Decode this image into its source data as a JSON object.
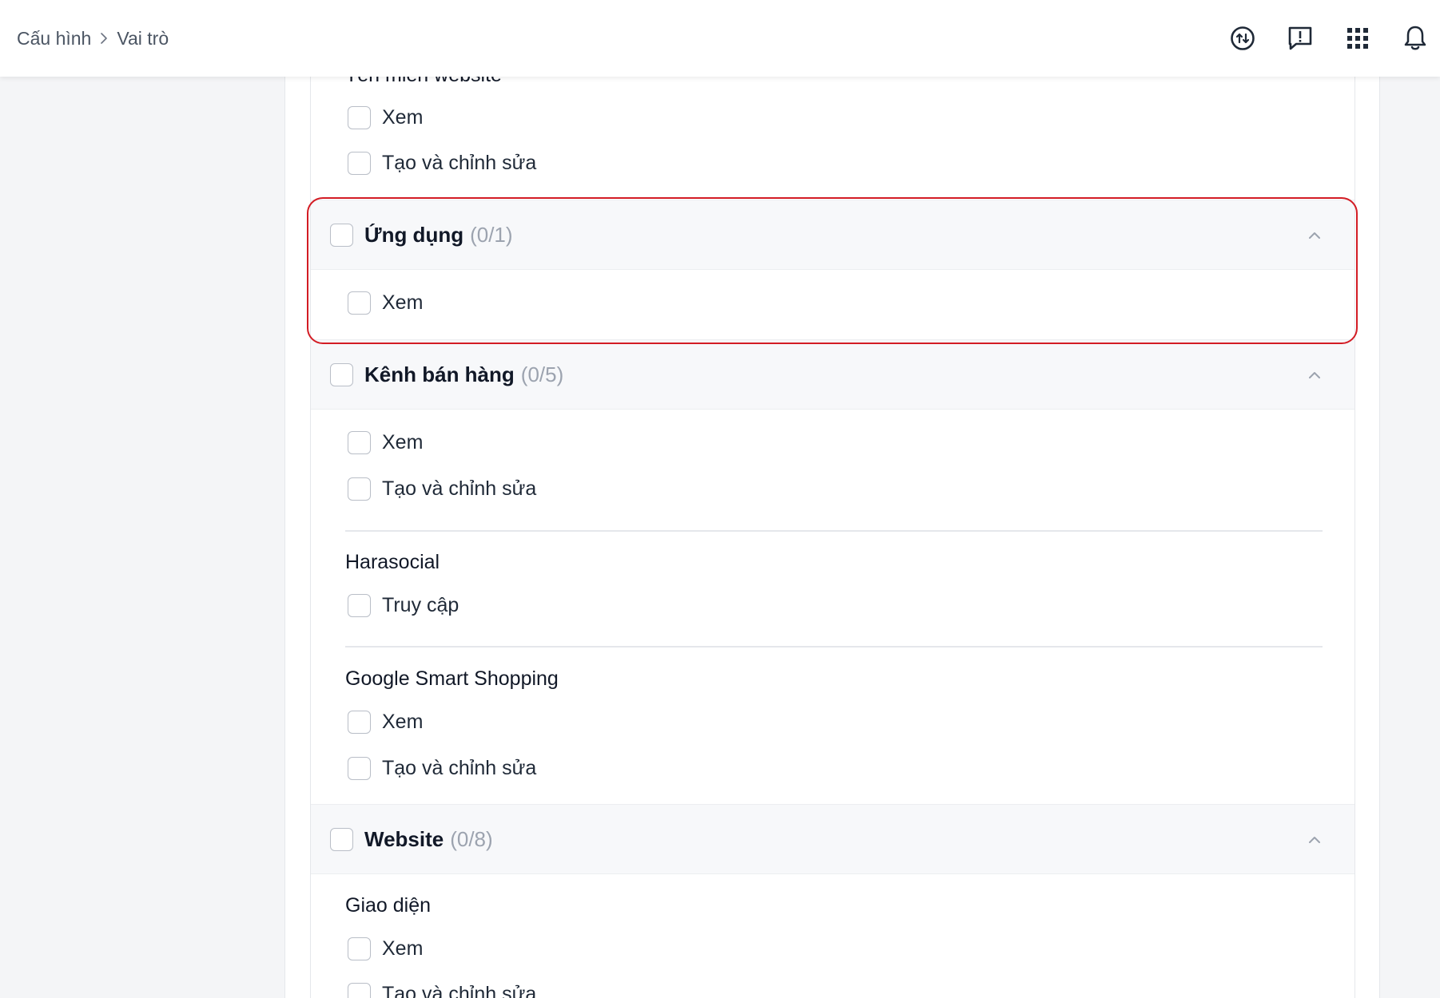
{
  "breadcrumb": {
    "parent": "Cấu hình",
    "current": "Vai trò"
  },
  "top_icons": [
    "sync-icon",
    "feedback-icon",
    "apps-grid-icon",
    "bell-icon"
  ],
  "partial_section": {
    "title": "Tên miền website",
    "items": [
      "Xem",
      "Tạo và chỉnh sửa"
    ]
  },
  "groups": {
    "ung_dung": {
      "title": "Ứng dụng",
      "count": "(0/1)",
      "items": [
        "Xem"
      ]
    },
    "kenh_ban_hang": {
      "title": "Kênh bán hàng",
      "count": "(0/5)",
      "items": [
        "Xem",
        "Tạo và chỉnh sửa"
      ],
      "subsections": [
        {
          "title": "Harasocial",
          "items": [
            "Truy cập"
          ]
        },
        {
          "title": "Google Smart Shopping",
          "items": [
            "Xem",
            "Tạo và chỉnh sửa"
          ]
        }
      ]
    },
    "website": {
      "title": "Website",
      "count": "(0/8)",
      "subsections": [
        {
          "title": "Giao diện",
          "items": [
            "Xem",
            "Tạo và chỉnh sửa"
          ]
        }
      ]
    }
  },
  "colors": {
    "highlight": "#d31c24",
    "group_header_bg": "#f7f8fa",
    "count_text": "#9ca3af"
  }
}
